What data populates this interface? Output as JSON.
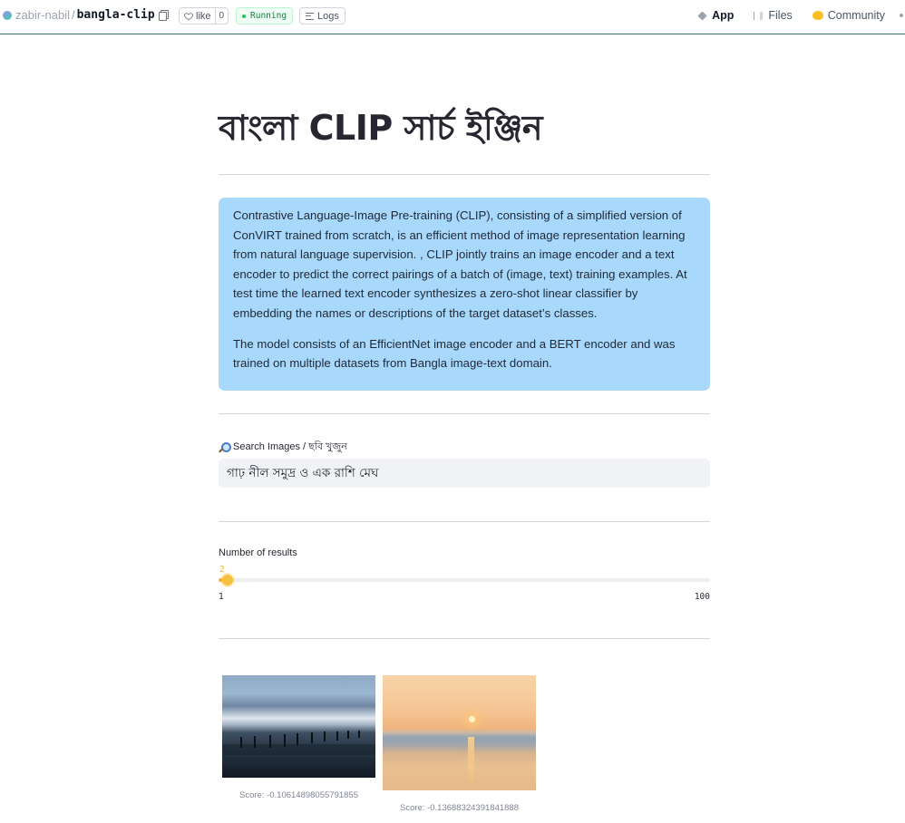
{
  "header": {
    "owner": "zabir-nabil",
    "repo": "bangla-clip",
    "like_label": "like",
    "like_count": "0",
    "status": "Running",
    "logs_label": "Logs",
    "nav": {
      "app": "App",
      "files": "Files",
      "community": "Community"
    }
  },
  "main": {
    "title": "বাংলা CLIP সার্চ ইঞ্জিন",
    "description": [
      "Contrastive Language-Image Pre-training (CLIP), consisting of a simplified version of ConVIRT trained from scratch, is an efficient method of image representation learning from natural language supervision. , CLIP jointly trains an image encoder and a text encoder to predict the correct pairings of a batch of (image, text) training examples. At test time the learned text encoder synthesizes a zero-shot linear classifier by embedding the names or descriptions of the target dataset’s classes.",
      "The model consists of an EfficientNet image encoder and a BERT encoder and was trained on multiple datasets from Bangla image-text domain."
    ],
    "search": {
      "label": "Search Images / ছবি খুজুন",
      "value": "গাঢ় নীল সমুদ্র ও এক রাশি মেঘ"
    },
    "slider": {
      "label": "Number of results",
      "value": "2",
      "min": "1",
      "max": "100",
      "accent": "#f0b429"
    },
    "results": [
      {
        "caption": "Score: -0.10614898055791855"
      },
      {
        "caption": "Score: -0.13688324391841888"
      }
    ]
  },
  "colors": {
    "info_bg": "#a8d8fb",
    "running_green": "#15803d",
    "divider": "#d5d6d9"
  }
}
